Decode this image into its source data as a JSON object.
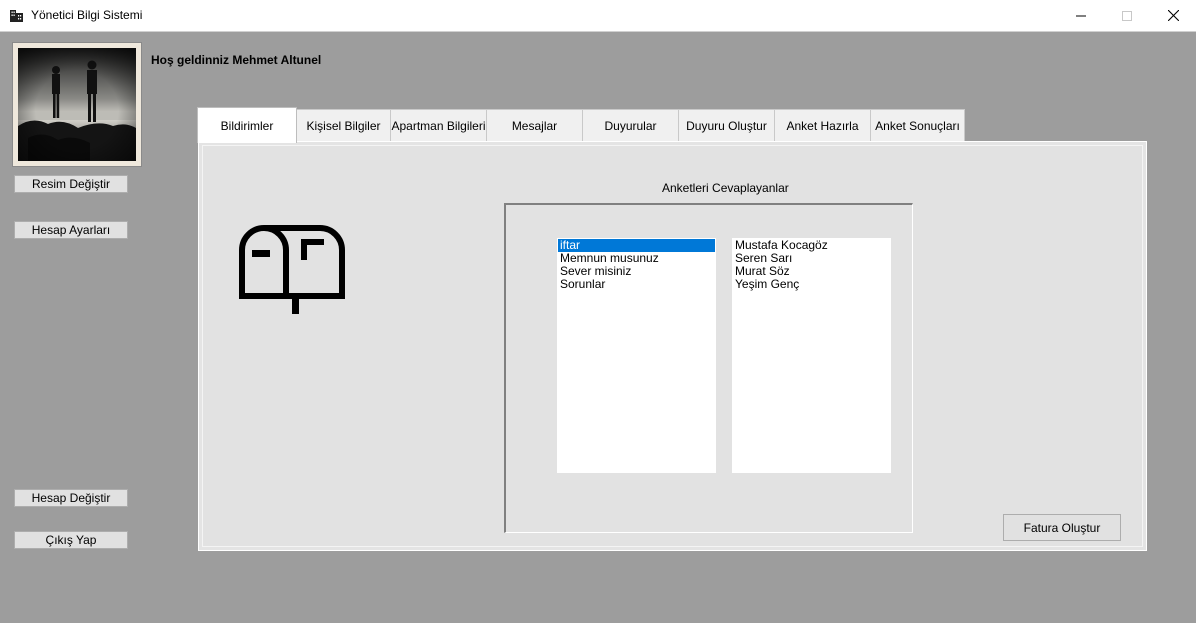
{
  "window": {
    "title": "Yönetici Bilgi Sistemi",
    "app_icon": "building-icon",
    "controls": [
      "minimize-icon",
      "maximize-icon",
      "close-icon"
    ]
  },
  "sidebar": {
    "change_photo_label": "Resim Değiştir",
    "account_settings_label": "Hesap Ayarları",
    "switch_account_label": "Hesap Değiştir",
    "logout_label": "Çıkış Yap"
  },
  "header": {
    "welcome_text": "Hoş geldinniz Mehmet Altunel"
  },
  "tabs": [
    {
      "label": "Bildirimler",
      "active": true
    },
    {
      "label": "Kişisel Bilgiler",
      "active": false
    },
    {
      "label": "Apartman Bilgileri",
      "active": false
    },
    {
      "label": "Mesajlar",
      "active": false
    },
    {
      "label": "Duyurular",
      "active": false
    },
    {
      "label": "Duyuru Oluştur",
      "active": false
    },
    {
      "label": "Anket Hazırla",
      "active": false
    },
    {
      "label": "Anket Sonuçları",
      "active": false
    }
  ],
  "panel": {
    "icon": "mailbox-icon",
    "group_title": "Anketleri Cevaplayanlar",
    "surveys": [
      "iftar",
      "Memnun musunuz",
      "Sever misiniz",
      "Sorunlar"
    ],
    "selected_survey": "iftar",
    "respondents": [
      "Mustafa Kocagöz",
      "Seren Sarı",
      "Murat Söz",
      "Yeşim Genç"
    ],
    "invoice_button_label": "Fatura Oluştur"
  },
  "colors": {
    "background": "#9d9d9d",
    "panel": "#e2e2e2",
    "selection": "#0078d7"
  }
}
